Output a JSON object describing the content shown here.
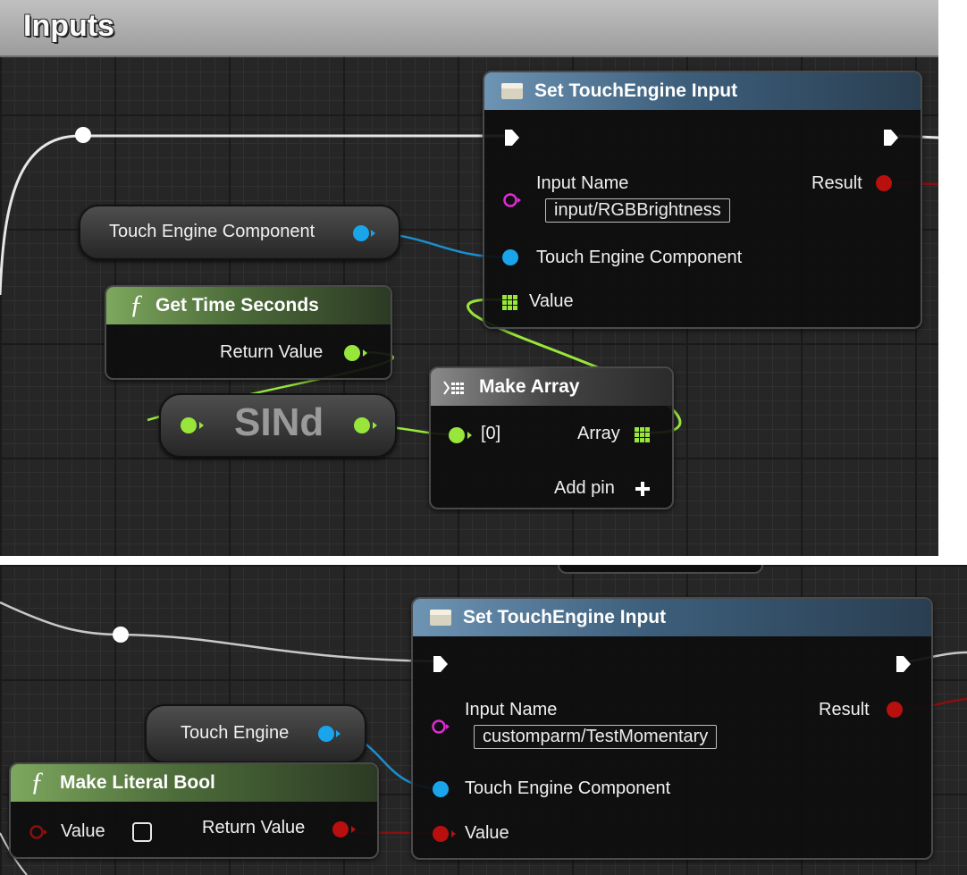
{
  "top_panel": {
    "title": "Inputs",
    "set_node": {
      "title": "Set TouchEngine Input",
      "input_name_label": "Input Name",
      "input_name_value": "input/RGBBrightness",
      "result_label": "Result",
      "component_label": "Touch Engine Component",
      "value_label": "Value"
    },
    "component_var_label": "Touch Engine Component",
    "time_node": {
      "title": "Get Time Seconds",
      "return_label": "Return Value"
    },
    "sind_label": "SINd",
    "make_array": {
      "title": "Make Array",
      "index_label": "[0]",
      "array_label": "Array",
      "add_pin_label": "Add pin"
    }
  },
  "bottom_panel": {
    "set_node": {
      "title": "Set TouchEngine Input",
      "input_name_label": "Input Name",
      "input_name_value": "customparm/TestMomentary",
      "result_label": "Result",
      "component_label": "Touch Engine Component",
      "value_label": "Value"
    },
    "component_var_label": "Touch Engine",
    "bool_node": {
      "title": "Make Literal Bool",
      "value_label": "Value",
      "return_label": "Return Value",
      "checked": false
    }
  },
  "colors": {
    "object_pin": "#1aa4ea",
    "float_pin": "#98e63c",
    "bool_pin": "#b80f0f",
    "string_pin": "#e02ad6",
    "exec_pin": "#ffffff"
  },
  "icons": [
    "function-icon",
    "make-array-icon",
    "set-node-icon",
    "add-pin-icon",
    "array-grid-icon",
    "exec-pin-icon"
  ]
}
